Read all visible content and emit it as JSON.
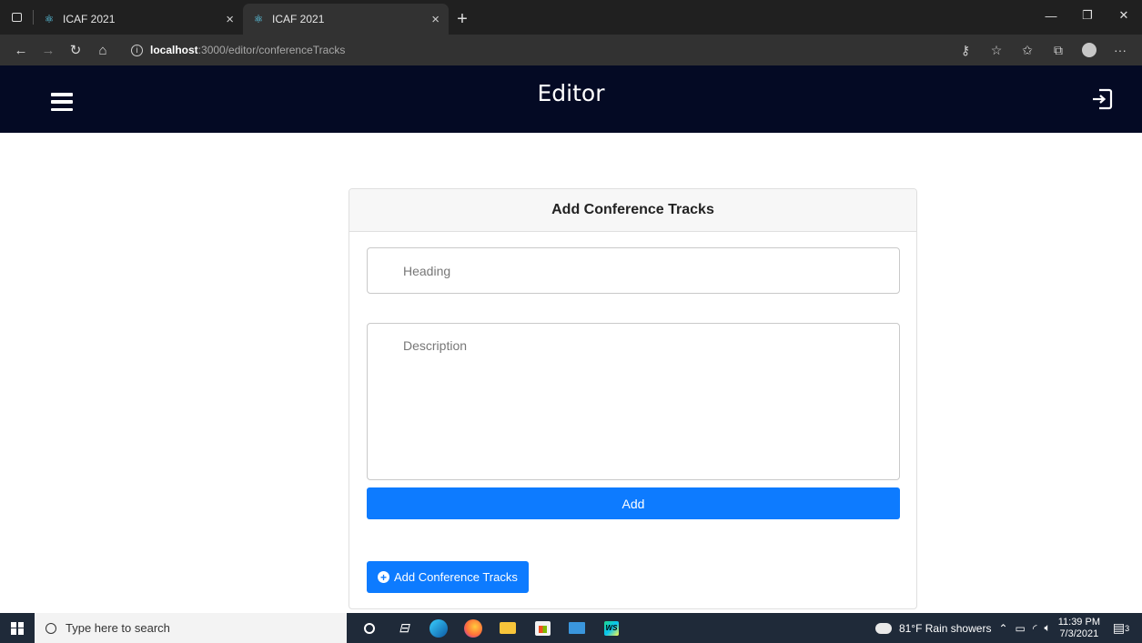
{
  "browser": {
    "tabs": [
      {
        "title": "ICAF 2021",
        "icon": "react-icon",
        "active": false
      },
      {
        "title": "ICAF 2021",
        "icon": "react-icon",
        "active": true
      }
    ],
    "url_host": "localhost",
    "url_path": ":3000/editor/conferenceTracks"
  },
  "header": {
    "title": "Editor"
  },
  "card": {
    "title": "Add Conference Tracks",
    "heading_placeholder": "Heading",
    "heading_value": "",
    "description_placeholder": "Description",
    "description_value": "",
    "add_label": "Add",
    "add_tracks_label": "Add Conference Tracks"
  },
  "taskbar": {
    "search_placeholder": "Type here to search",
    "weather": "81°F  Rain showers",
    "time": "11:39 PM",
    "date": "7/3/2021",
    "notification_count": "3"
  },
  "colors": {
    "header_bg": "#040a24",
    "primary_button": "#0d7bff",
    "card_header_bg": "#f7f7f7"
  }
}
